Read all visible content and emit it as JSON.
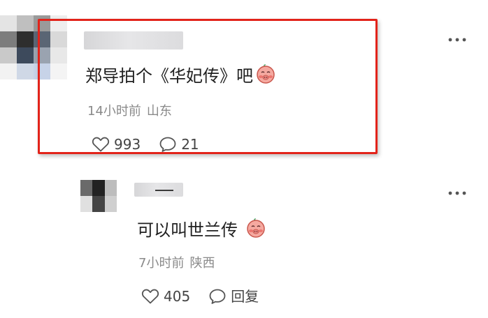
{
  "comments": [
    {
      "text": "郑导拍个《华妃传》吧",
      "time": "14小时前",
      "location": "山东",
      "likes": "993",
      "replies": "21",
      "highlighted": true,
      "emoji": "blushing-pig-emoji"
    },
    {
      "text": "可以叫世兰传",
      "time": "7小时前",
      "location": "陕西",
      "likes": "405",
      "reply_label": "回复",
      "emoji": "blushing-pig-emoji"
    }
  ],
  "avatars": {
    "first": [
      "#e4e4e4",
      "#bfbfbf",
      "#9a9a9a",
      "#eeeeee",
      "#7d7d7d",
      "#2e2e2e",
      "#5a6574",
      "#d9d9d9",
      "#c9c9c9",
      "#3d4a5c",
      "#9aa3b0",
      "#e8e8e8",
      "#f2f2f2",
      "#cfd8e6",
      "#c7d3e8",
      "#f4f4f4"
    ],
    "second": [
      "#6a6a6a",
      "#222222",
      "#bdbdbd",
      "#e0e0e0",
      "#444444",
      "#cfcfcf"
    ]
  },
  "colors": {
    "highlight_border": "#e2231a",
    "text_primary": "#1f1f1f",
    "text_meta": "#8a8a8a"
  },
  "icons": {
    "like": "heart-outline-icon",
    "comment": "speech-bubble-icon",
    "more": "more-dots-icon"
  }
}
